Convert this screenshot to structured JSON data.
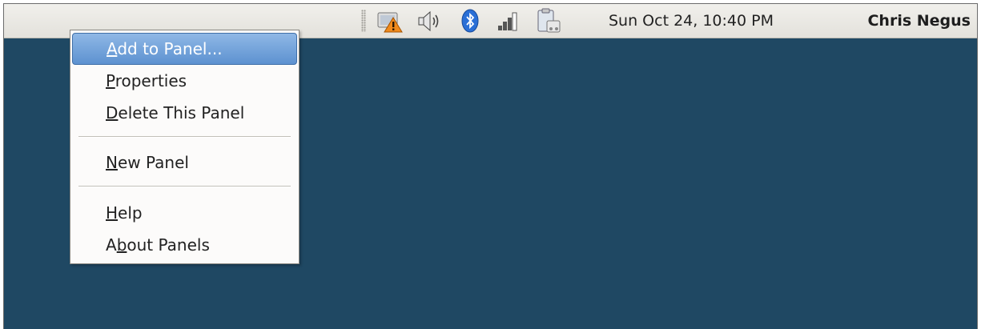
{
  "panel": {
    "clock": "Sun Oct 24, 10:40 PM",
    "user": "Chris Negus",
    "tray_icons": [
      "network-warning-icon",
      "volume-icon",
      "bluetooth-icon",
      "signal-strength-icon",
      "clipboard-icon"
    ]
  },
  "menu": {
    "items": [
      {
        "mnemonic": "A",
        "rest": "dd to Panel..."
      },
      {
        "mnemonic": "P",
        "rest": "roperties"
      },
      {
        "mnemonic": "D",
        "rest": "elete This Panel"
      },
      {
        "mnemonic": "N",
        "rest": "ew Panel"
      },
      {
        "mnemonic": "H",
        "rest": "elp"
      },
      {
        "pre": "A",
        "mnemonic": "b",
        "rest": "out Panels"
      }
    ]
  },
  "colors": {
    "desktop": "#1f4863",
    "panel": "#e8e6e1",
    "menu_highlight": "#6a9dd8",
    "warning": "#f08a1c",
    "bluetooth": "#2a6fd6"
  }
}
